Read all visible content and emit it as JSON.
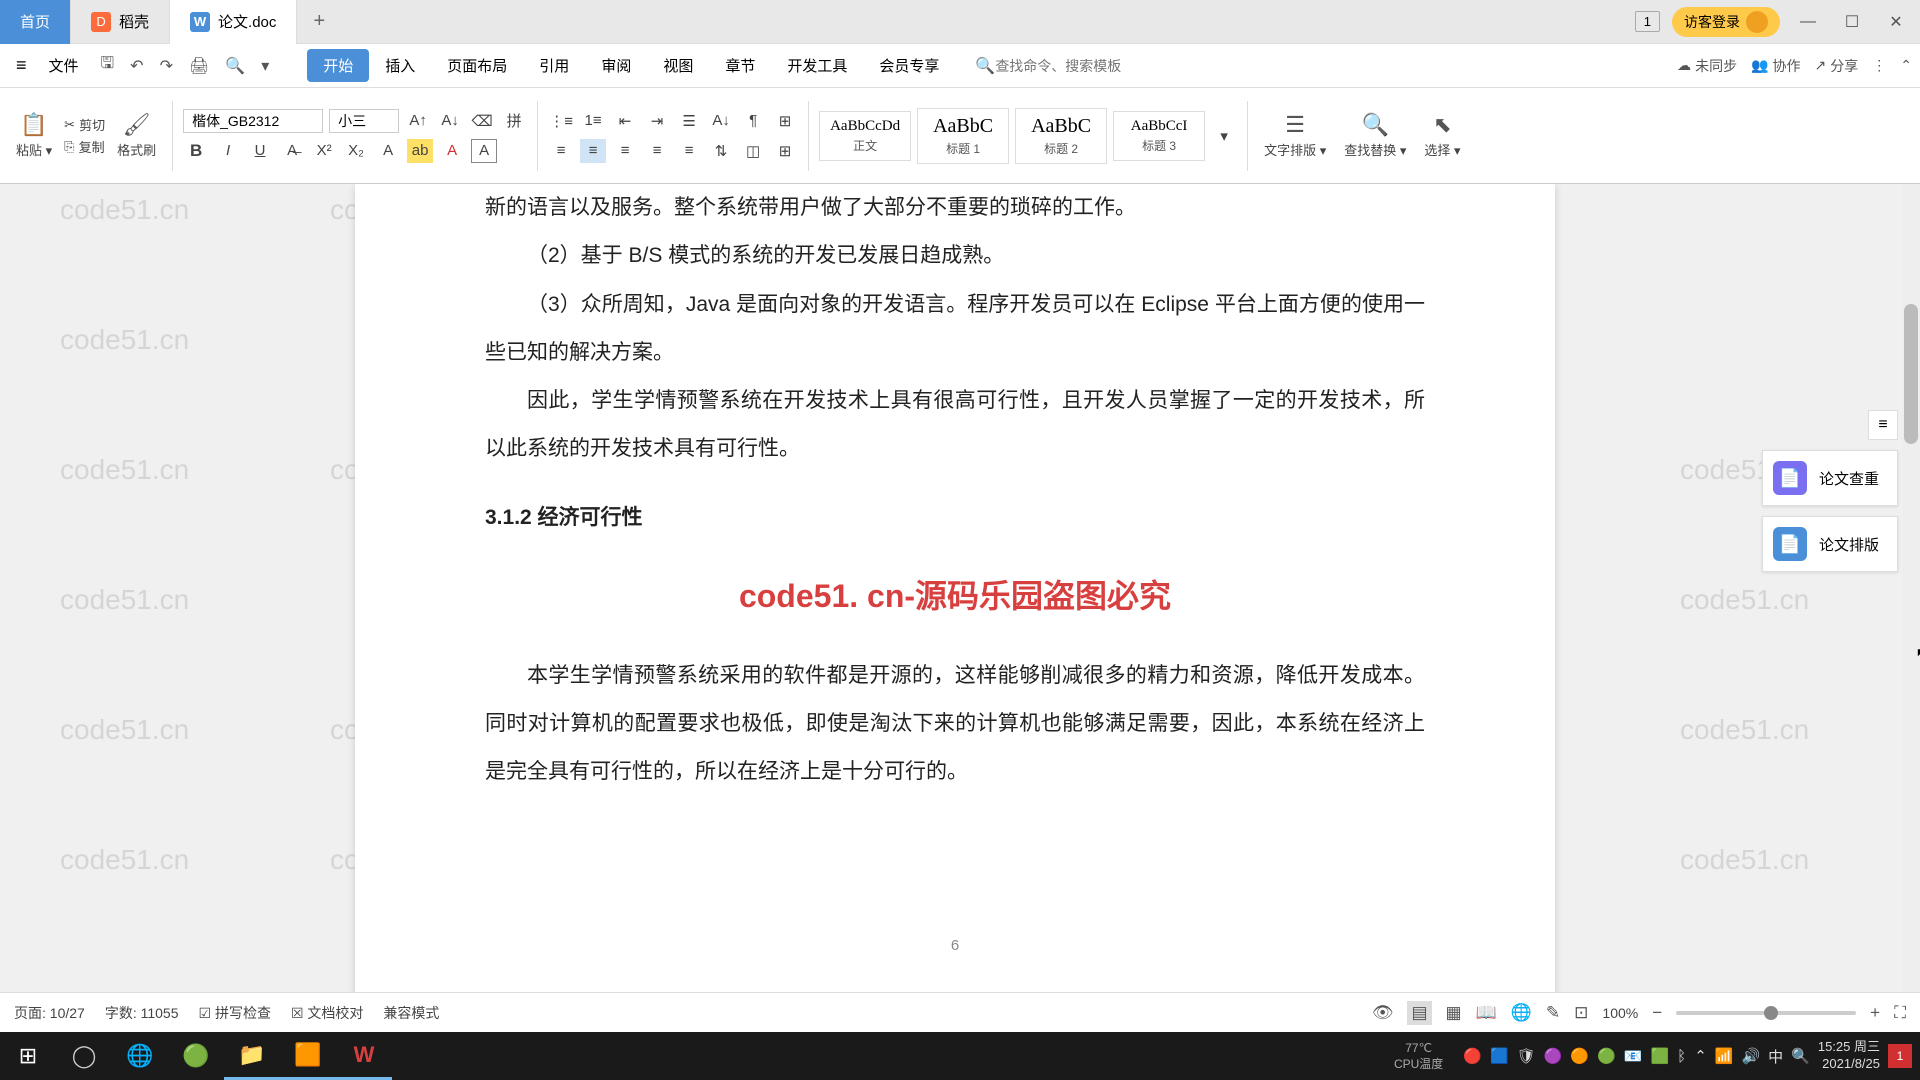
{
  "tabs": {
    "home": "首页",
    "daoke": "稻壳",
    "doc": "论文.doc"
  },
  "title_right": {
    "count": "1",
    "guest": "访客登录"
  },
  "menu": {
    "file": "文件",
    "start": "开始",
    "insert": "插入",
    "page_layout": "页面布局",
    "reference": "引用",
    "review": "审阅",
    "view": "视图",
    "chapter": "章节",
    "dev": "开发工具",
    "vip": "会员专享",
    "search_placeholder": "查找命令、搜索模板",
    "unsync": "未同步",
    "collab": "协作",
    "share": "分享"
  },
  "ribbon": {
    "paste": "粘贴",
    "cut": "剪切",
    "copy": "复制",
    "format_painter": "格式刷",
    "font": "楷体_GB2312",
    "size": "小三",
    "styles": {
      "body": {
        "preview": "AaBbCcDd",
        "name": "正文"
      },
      "h1": {
        "preview": "AaBbC",
        "name": "标题 1"
      },
      "h2": {
        "preview": "AaBbC",
        "name": "标题 2"
      },
      "h3": {
        "preview": "AaBbCcI",
        "name": "标题 3"
      }
    },
    "text_layout": "文字排版",
    "find_replace": "查找替换",
    "select": "选择"
  },
  "document": {
    "line1": "新的语言以及服务。整个系统带用户做了大部分不重要的琐碎的工作。",
    "line2": "（2）基于 B/S 模式的系统的开发已发展日趋成熟。",
    "line3": "（3）众所周知，Java 是面向对象的开发语言。程序开发员可以在 Eclipse 平台上面方便的使用一些已知的解决方案。",
    "line4": "因此，学生学情预警系统在开发技术上具有很高可行性，且开发人员掌握了一定的开发技术，所以此系统的开发技术具有可行性。",
    "heading": "3.1.2 经济可行性",
    "watermark_center": "code51. cn-源码乐园盗图必究",
    "line5": "本学生学情预警系统采用的软件都是开源的，这样能够削减很多的精力和资源，降低开发成本。同时对计算机的配置要求也极低，即使是淘汰下来的计算机也能够满足需要，因此，本系统在经济上是完全具有可行性的，所以在经济上是十分可行的。",
    "page_num": "6"
  },
  "side": {
    "check": "论文查重",
    "layout": "论文排版"
  },
  "status": {
    "page": "页面: 10/27",
    "words": "字数: 11055",
    "spell": "拼写检查",
    "docproof": "文档校对",
    "compat": "兼容模式",
    "zoom": "100%"
  },
  "taskbar": {
    "cpu_label": "CPU温度",
    "cpu_temp": "77℃",
    "ime": "中",
    "time": "15:25 周三",
    "date": "2021/8/25",
    "notif": "1"
  },
  "watermark_text": "code51.cn"
}
